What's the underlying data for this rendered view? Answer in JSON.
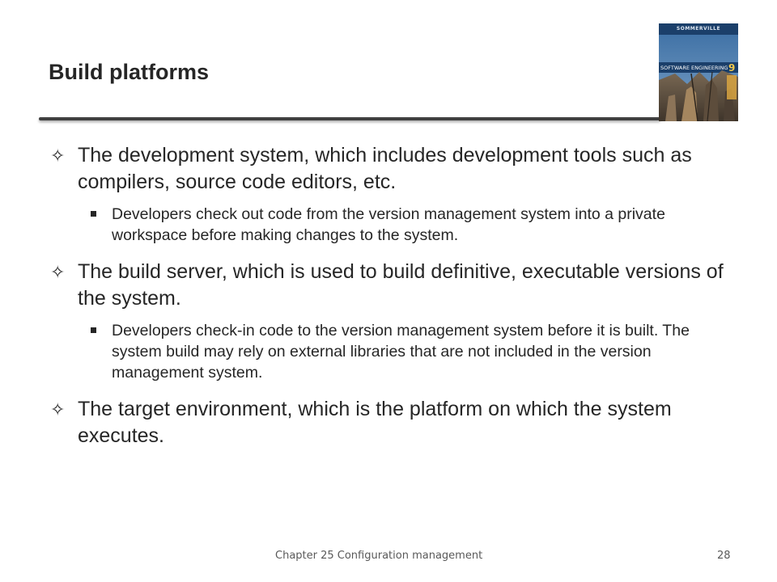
{
  "slide": {
    "title": "Build platforms",
    "cover": {
      "author": "SOMMERVILLE",
      "book_title": "SOFTWARE ENGINEERING",
      "edition": "9"
    },
    "bullets": [
      {
        "text": "The development system, which includes development tools such as compilers, source code editors, etc.",
        "sub": [
          "Developers check out code from the version management system into a private workspace before making changes to the system."
        ]
      },
      {
        "text": "The build server, which is used to build definitive, executable versions of the system.",
        "sub": [
          "Developers check-in code to the version management system before it is built. The system build may rely on external libraries that are not included in the version management system."
        ]
      },
      {
        "text": "The target environment, which is the platform on which the system executes.",
        "sub": []
      }
    ],
    "footer": {
      "center": "Chapter 25 Configuration management",
      "page": "28"
    },
    "colors": {
      "text": "#262626",
      "rule": "#404040",
      "cover_bg": "#2f5b8a",
      "cover_band": "#1b3f6a"
    }
  }
}
